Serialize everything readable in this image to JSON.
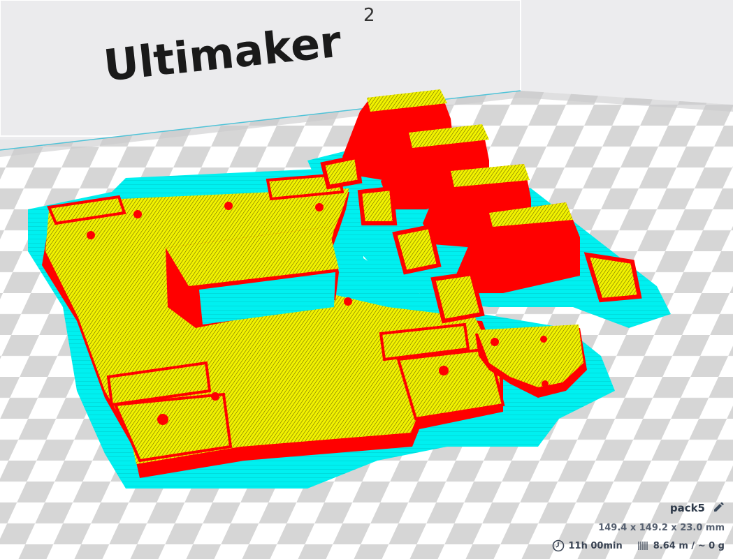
{
  "viewport": {
    "brand_text": "Ultimaker",
    "brand_superscript": "2",
    "colors": {
      "wall": "#ff0000",
      "infill": "#ffff00",
      "support": "#00ffff",
      "build_plate": "#cfcfcf",
      "checker_light": "#ffffff",
      "checker_dark": "#d9d9d9",
      "background": "#e7e7e9"
    }
  },
  "job": {
    "name": "pack5",
    "dimensions": "149.4 x 149.2 x 23.0 mm",
    "print_time": "11h 00min",
    "material": "8.64 m / ~ 0 g"
  },
  "icons": {
    "edit": "pencil-icon",
    "time": "clock-icon",
    "material": "filament-spool-icon"
  }
}
